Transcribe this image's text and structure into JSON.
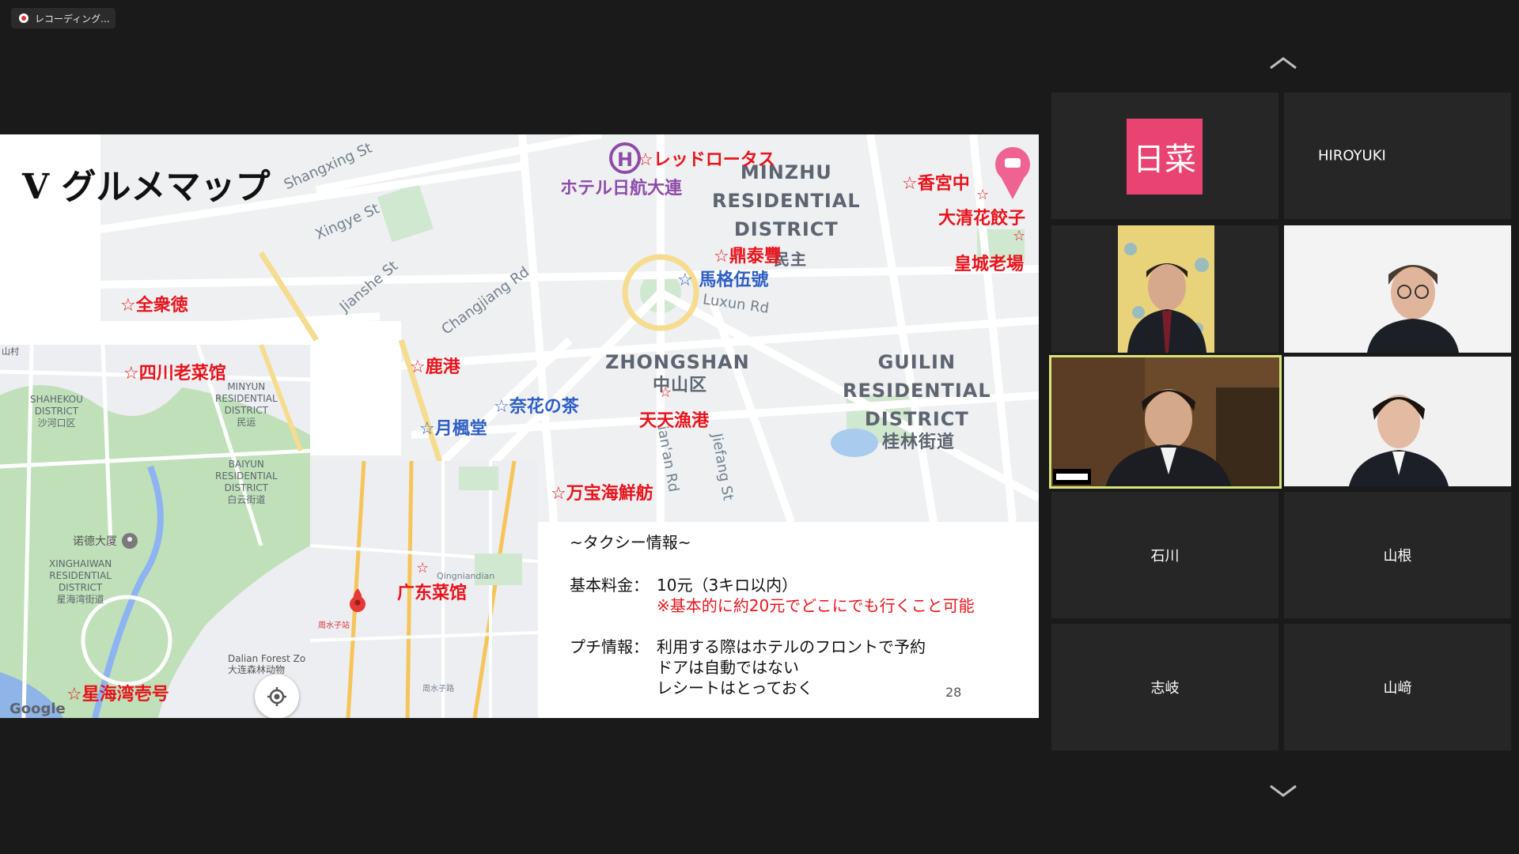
{
  "recording": {
    "label": "レコーディング..."
  },
  "slide": {
    "title": "Ⅴ グルメマップ",
    "page_number": "28",
    "restaurants": {
      "red_lotus": "☆レッドロータス",
      "hotel_nikko": "ホテル日航大連",
      "xianggong": "☆香宮中",
      "qinghua": "大清花餃子",
      "star1": "☆",
      "star2": "☆",
      "huangcheng": "皇城老場",
      "dingtaifeng": "☆鼎泰豐",
      "mageru": "☆ 馬格伍號",
      "quanjude": "☆全衆徳",
      "sichuan": "☆四川老菜馆",
      "lugang": "☆鹿港",
      "naihua": "☆奈花の茶",
      "yuefeng": "☆月楓堂",
      "tiantian_star": "☆",
      "tiantian": "天天漁港",
      "wanbao": "☆万宝海鮮舫",
      "guangdong_star": "☆",
      "guangdong": "广东菜馆",
      "xinghai": "☆星海湾壱号"
    },
    "map_labels": {
      "minzhu": [
        "MINZHU",
        "RESIDENTIAL",
        "DISTRICT"
      ],
      "minzhu_cn": "民主",
      "zhongshan": "ZHONGSHAN",
      "zhongshan_cn": "中山区",
      "guilin": [
        "GUILIN",
        "RESIDENTIAL",
        "DISTRICT"
      ],
      "guilin_cn": "桂林街道",
      "shahekou": [
        "SHAHEKOU",
        "DISTRICT",
        "沙河口区"
      ],
      "minyun": [
        "MINYUN",
        "RESIDENTIAL",
        "DISTRICT",
        "民运"
      ],
      "baiyun": [
        "BAIYUN",
        "RESIDENTIAL",
        "DISTRICT",
        "白云街道"
      ],
      "xinghaiwan": [
        "XINGHAIWAN",
        "RESIDENTIAL",
        "DISTRICT",
        "星海湾街道"
      ],
      "nuode": "诺德大厦",
      "dalian_forest": [
        "Dalian Forest Zo",
        "大连森林动物"
      ],
      "shanzhu": "山村",
      "google": "Google",
      "roads": {
        "shangxing": "Shangxing St",
        "xingye": "Xingye St",
        "jianshe": "Jianshe St",
        "changjiang": "Changjiang Rd",
        "luxun": "Luxun Rd",
        "jiefang": "Jiefang St",
        "tianan": "ian'an Rd",
        "qingniandian": "Qingniandian",
        "zhoushuizi": "周水子站",
        "zhoushuizi2": "周水子路"
      }
    },
    "taxi_info": {
      "heading": "~タクシー情報~",
      "base_fare_label": "基本料金：",
      "base_fare_value": "10元（3キロ以内）",
      "base_fare_note": "※基本的に約20元でどこにでも行くこと可能",
      "tips_label": "プチ情報：",
      "tips": [
        "利用する際はホテルのフロントで予約",
        "ドアは自動ではない",
        "レシートはとっておく"
      ]
    }
  },
  "gallery": {
    "participants": [
      {
        "id": "hina",
        "name": "日菜",
        "type": "avatar"
      },
      {
        "id": "hiroyuki",
        "name": "HIROYUKI",
        "type": "name"
      },
      {
        "id": "video1",
        "type": "video"
      },
      {
        "id": "video2",
        "type": "video"
      },
      {
        "id": "video3",
        "type": "video",
        "speaking": true
      },
      {
        "id": "video4",
        "type": "video"
      },
      {
        "id": "ishikawa",
        "name": "石川",
        "type": "name"
      },
      {
        "id": "yamane",
        "name": "山根",
        "type": "name"
      },
      {
        "id": "shiki",
        "name": "志岐",
        "type": "name"
      },
      {
        "id": "yamasaki",
        "name": "山﨑",
        "type": "name"
      }
    ]
  },
  "colors": {
    "accent_avatar": "#e94372",
    "speaker_border": "#d7e47a",
    "red_text": "#e8131b",
    "blue_text": "#2f5fc4"
  }
}
